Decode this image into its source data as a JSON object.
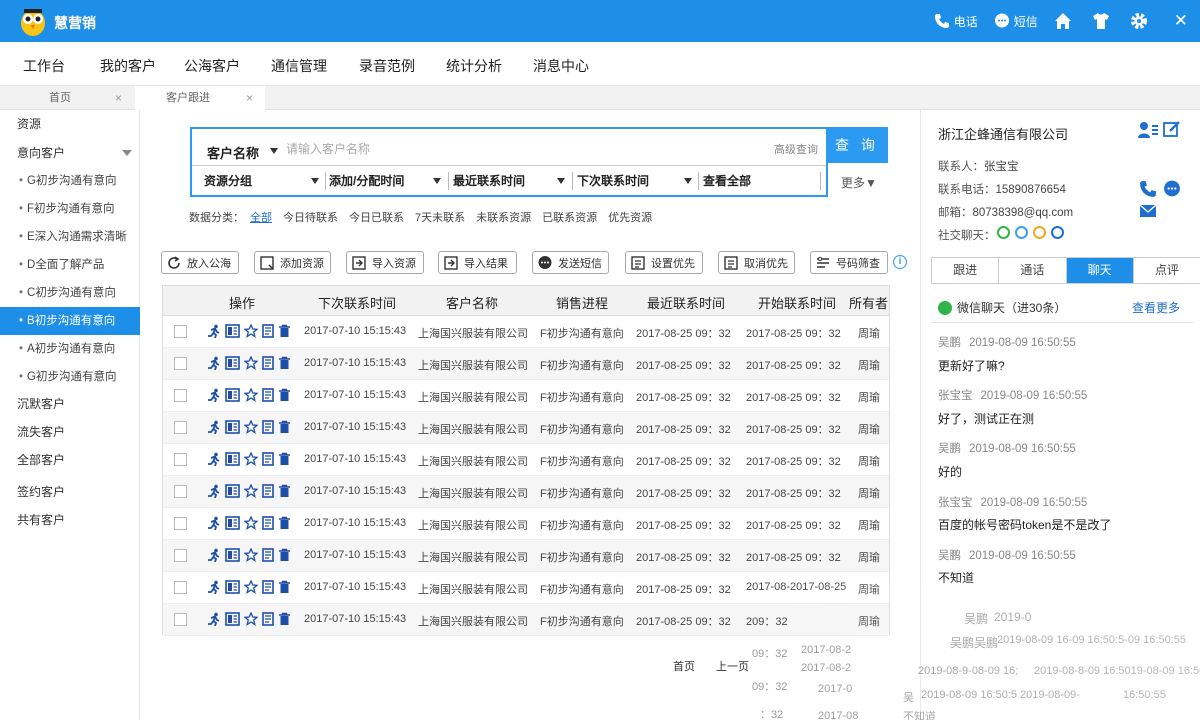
{
  "app": {
    "title": "慧营销",
    "brand_color": "#1e8fe8",
    "top_actions": [
      {
        "icon": "phone-icon",
        "label": "电话"
      },
      {
        "icon": "sms-icon",
        "label": "短信"
      },
      {
        "icon": "home-icon",
        "label": ""
      },
      {
        "icon": "skin-icon",
        "label": ""
      },
      {
        "icon": "settings-icon",
        "label": ""
      },
      {
        "icon": "close-icon",
        "label": "✕"
      }
    ]
  },
  "nav": [
    "工作台",
    "我的客户",
    "公海客户",
    "通信管理",
    "录音范例",
    "统计分析",
    "消息中心"
  ],
  "page_tabs": [
    {
      "label": "首页",
      "close": "×"
    },
    {
      "label": "客户跟进",
      "close": "×"
    }
  ],
  "sidebar": {
    "items": [
      {
        "label": "资源",
        "type": "top"
      },
      {
        "label": "意向客户",
        "type": "group"
      },
      {
        "label": "G初步沟通有意向",
        "type": "sub"
      },
      {
        "label": "F初步沟通有意向",
        "type": "sub"
      },
      {
        "label": "E深入沟通需求清晰",
        "type": "sub"
      },
      {
        "label": "D全面了解产品",
        "type": "sub"
      },
      {
        "label": "C初步沟通有意向",
        "type": "sub"
      },
      {
        "label": "B初步沟通有意向",
        "type": "sub",
        "active": true
      },
      {
        "label": "A初步沟通有意向",
        "type": "sub"
      },
      {
        "label": "G初步沟通有意向",
        "type": "sub"
      },
      {
        "label": "沉默客户",
        "type": "top"
      },
      {
        "label": "流失客户",
        "type": "top"
      },
      {
        "label": "全部客户",
        "type": "top"
      },
      {
        "label": "签约客户",
        "type": "top"
      },
      {
        "label": "共有客户",
        "type": "top"
      }
    ]
  },
  "search": {
    "field_label": "客户名称",
    "placeholder": "请输入客户名称",
    "advanced": "高级查询",
    "button": "查 询",
    "more": "更多▼",
    "filters": [
      "资源分组",
      "添加/分配时间",
      "最近联系时间",
      "下次联系时间",
      "查看全部"
    ]
  },
  "classify": {
    "label": "数据分类：",
    "items": [
      "全部",
      "今日待联系",
      "今日已联系",
      "7天未联系",
      "未联系资源",
      "已联系资源",
      "优先资源"
    ],
    "active_index": 0
  },
  "toolbar": [
    {
      "label": "放入公海",
      "icon": "refresh-icon"
    },
    {
      "label": "添加资源",
      "icon": "add-resource-icon"
    },
    {
      "label": "导入资源",
      "icon": "import-icon"
    },
    {
      "label": "导入结果",
      "icon": "import-result-icon"
    },
    {
      "label": "发送短信",
      "icon": "sms-icon"
    },
    {
      "label": "设置优先",
      "icon": "list-icon"
    },
    {
      "label": "取消优先",
      "icon": "list-icon"
    },
    {
      "label": "号码筛查",
      "icon": "filter-icon"
    }
  ],
  "table": {
    "columns": [
      "操作",
      "下次联系时间",
      "客户名称",
      "销售进程",
      "最近联系时间",
      "开始联系时间",
      "所有者"
    ],
    "rows": [
      {
        "next": "2017-07-10 15:15:43",
        "name": "上海国兴服装有限公司",
        "stage": "F初步沟通有意向",
        "last": "2017-08-25 09：32",
        "start": "2017-08-25 09：32",
        "owner": "周瑜"
      },
      {
        "next": "2017-07-10 15:15:43",
        "name": "上海国兴服装有限公司",
        "stage": "F初步沟通有意向",
        "last": "2017-08-25 09：32",
        "start": "2017-08-25 09：32",
        "owner": "周瑜"
      },
      {
        "next": "2017-07-10 15:15:43",
        "name": "上海国兴服装有限公司",
        "stage": "F初步沟通有意向",
        "last": "2017-08-25 09：32",
        "start": "2017-08-25 09：32",
        "owner": "周瑜"
      },
      {
        "next": "2017-07-10 15:15:43",
        "name": "上海国兴服装有限公司",
        "stage": "F初步沟通有意向",
        "last": "2017-08-25 09：32",
        "start": "2017-08-25 09：32",
        "owner": "周瑜"
      },
      {
        "next": "2017-07-10 15:15:43",
        "name": "上海国兴服装有限公司",
        "stage": "F初步沟通有意向",
        "last": "2017-08-25 09：32",
        "start": "2017-08-25 09：32",
        "owner": "周瑜"
      },
      {
        "next": "2017-07-10 15:15:43",
        "name": "上海国兴服装有限公司",
        "stage": "F初步沟通有意向",
        "last": "2017-08-25 09：32",
        "start": "2017-08-25 09：32",
        "owner": "周瑜"
      },
      {
        "next": "2017-07-10 15:15:43",
        "name": "上海国兴服装有限公司",
        "stage": "F初步沟通有意向",
        "last": "2017-08-25 09：32",
        "start": "2017-08-25 09：32",
        "owner": "周瑜"
      },
      {
        "next": "2017-07-10 15:15:43",
        "name": "上海国兴服装有限公司",
        "stage": "F初步沟通有意向",
        "last": "2017-08-25 09：32",
        "start": "2017-08-25 09：32",
        "owner": "周瑜"
      },
      {
        "next": "2017-07-10 15:15:43",
        "name": "上海国兴服装有限公司",
        "stage": "F初步沟通有意向",
        "last": "2017-08-25 09：32",
        "start": "2017-08-2017-08-25",
        "owner": "周瑜"
      },
      {
        "next": "2017-07-10 15:15:43",
        "name": "上海国兴服装有限公司",
        "stage": "F初步沟通有意向",
        "last": "2017-08-25 09：32",
        "start": "209：32",
        "owner": "周瑜"
      }
    ]
  },
  "pagination": {
    "first": "首页",
    "prev": "上一页"
  },
  "contact": {
    "company": "浙江企蜂通信有限公司",
    "person_label": "联系人：",
    "person": "张宝宝",
    "phone_label": "联系电话：",
    "phone": "15890876654",
    "email_label": "邮箱：",
    "email": "80738398@qq.com",
    "social_label": "社交聊天："
  },
  "contact_tabs": [
    "跟进",
    "通话",
    "聊天",
    "点评"
  ],
  "chat": {
    "header": "微信聊天（进30条）",
    "view_more": "查看更多",
    "messages": [
      {
        "sender": "吴鹏",
        "time": "2019-08-09 16:50:55",
        "text": "更新好了嘛?"
      },
      {
        "sender": "张宝宝",
        "time": "2019-08-09 16:50:55",
        "text": "好了，测试正在测"
      },
      {
        "sender": "吴鹏",
        "time": "2019-08-09 16:50:55",
        "text": "好的"
      },
      {
        "sender": "张宝宝",
        "time": "2019-08-09 16:50:55",
        "text": "百度的帐号密码token是不是改了"
      },
      {
        "sender": "吴鹏",
        "time": "2019-08-09 16:50:55",
        "text": "不知道"
      }
    ]
  },
  "ghost_text": [
    "吴鹏",
    "2019-0",
    "吴鹏吴鹏",
    "2019-08-09 16-09 16:50:5-09 16:50:55",
    "2019-08-9-08-09 16;",
    "2019-08-8-09 16:5019-08-09 16:50:55",
    "吴",
    "2019-08-09 16:50:5",
    "2019-08-09-",
    "16:50:55",
    "不知道",
    "2017-08-2",
    "09：32",
    "2017-08-2",
    "09：32",
    "2017-0",
    "：32",
    "2017-08"
  ]
}
